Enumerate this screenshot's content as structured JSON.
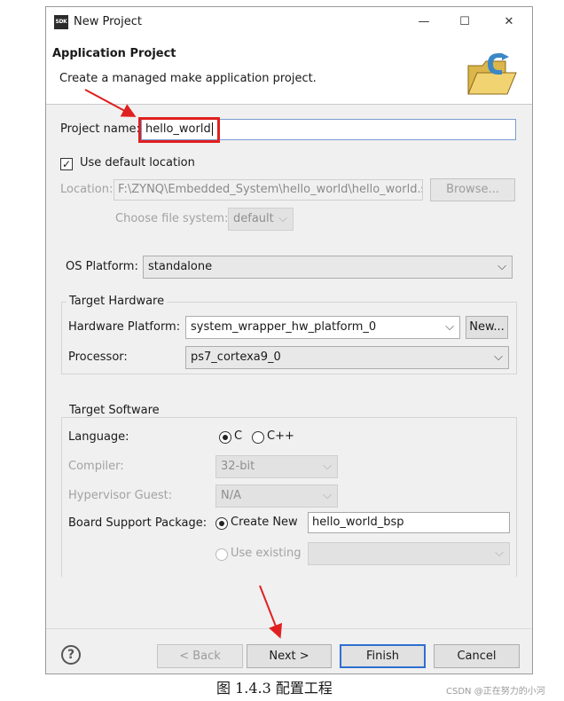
{
  "window": {
    "icon_text": "SDK",
    "title": "New Project",
    "minimize": "—",
    "maximize": "☐",
    "close": "✕"
  },
  "header": {
    "title": "Application Project",
    "description": "Create a managed make application project."
  },
  "project": {
    "name_label": "Project name:",
    "name_value": "hello_world",
    "use_default_label": "Use default location",
    "use_default_checked": true,
    "location_label": "Location:",
    "location_value": "F:\\ZYNQ\\Embedded_System\\hello_world\\hello_world.s",
    "browse_label": "Browse...",
    "file_system_label": "Choose file system:",
    "file_system_value": "default"
  },
  "os_platform": {
    "label": "OS Platform:",
    "value": "standalone"
  },
  "target_hardware": {
    "title": "Target Hardware",
    "platform_label": "Hardware Platform:",
    "platform_value": "system_wrapper_hw_platform_0",
    "new_label": "New...",
    "processor_label": "Processor:",
    "processor_value": "ps7_cortexa9_0"
  },
  "target_software": {
    "title": "Target Software",
    "language_label": "Language:",
    "lang_c": "C",
    "lang_cpp": "C++",
    "language_selected": "C",
    "compiler_label": "Compiler:",
    "compiler_value": "32-bit",
    "hypervisor_label": "Hypervisor Guest:",
    "hypervisor_value": "N/A",
    "bsp_label": "Board Support Package:",
    "create_new_label": "Create New",
    "bsp_name": "hello_world_bsp",
    "use_existing_label": "Use existing",
    "existing_value": ""
  },
  "footer": {
    "help": "?",
    "back": "< Back",
    "next": "Next >",
    "finish": "Finish",
    "cancel": "Cancel"
  },
  "caption": "图 1.4.3 配置工程",
  "watermark": "CSDN @正在努力的小河",
  "colors": {
    "annotation_red": "#e02020",
    "focus_blue": "#2f6fcf"
  }
}
